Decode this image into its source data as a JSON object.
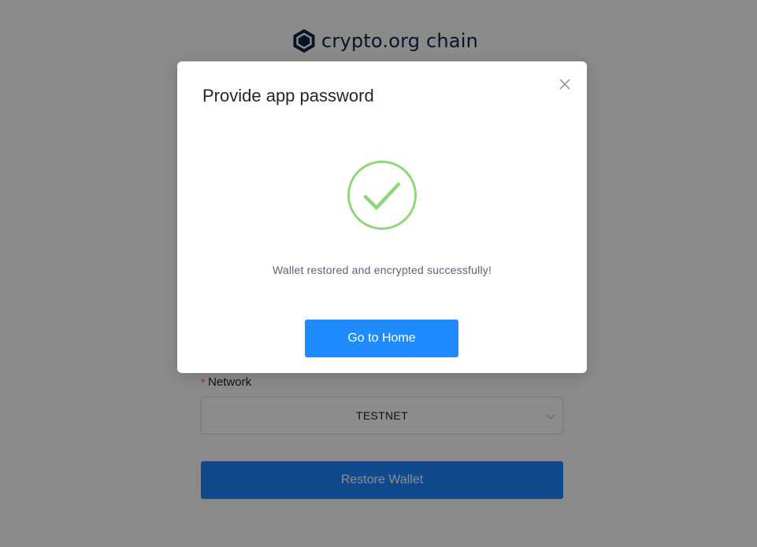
{
  "app": {
    "logo_text": "crypto.org chain",
    "logo_icon": "hexagon-logo-icon",
    "brand_color": "#0f2347"
  },
  "form": {
    "network_label": "Network",
    "required_mark": "*",
    "network_value": "TESTNET",
    "restore_button": "Restore Wallet"
  },
  "modal": {
    "title": "Provide app password",
    "close_icon": "close-icon",
    "success_icon": "check-circle-icon",
    "success_color": "#8fd67c",
    "message": "Wallet restored and encrypted successfully!",
    "home_button": "Go to Home",
    "button_color": "#1e8cff"
  }
}
